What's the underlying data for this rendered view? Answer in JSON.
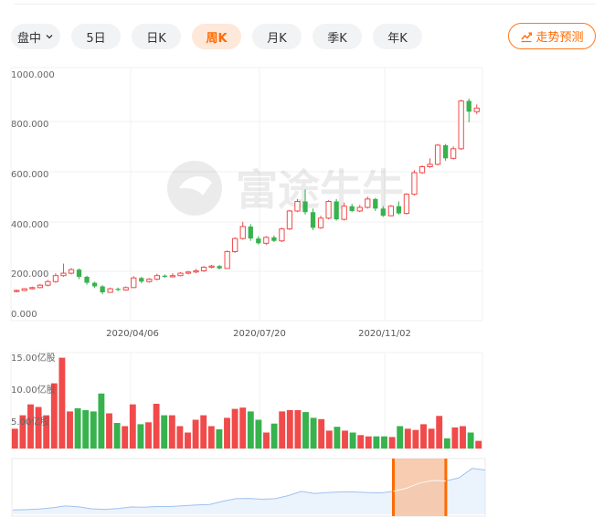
{
  "toolbar": {
    "tabs": [
      {
        "label": "盘中",
        "dropdown": true
      },
      {
        "label": "5日"
      },
      {
        "label": "日K"
      },
      {
        "label": "周K",
        "active": true
      },
      {
        "label": "月K"
      },
      {
        "label": "季K"
      },
      {
        "label": "年K"
      }
    ],
    "forecast_label": "走势预测"
  },
  "watermark": "富途牛牛",
  "colors": {
    "up": "#f04a4a",
    "down": "#37b24d",
    "accent": "#ff6a00",
    "grid": "#f0f0f0"
  },
  "chart_data": [
    {
      "type": "candlestick",
      "name": "price",
      "ylim": [
        0,
        1000
      ],
      "yticks": [
        "1000.000",
        "800.000",
        "600.000",
        "400.000",
        "200.000",
        "0.000"
      ],
      "xticks": [
        "2020/04/06",
        "2020/07/20",
        "2020/11/02"
      ],
      "candles": [
        [
          85,
          88,
          80,
          92
        ],
        [
          88,
          95,
          85,
          98
        ],
        [
          95,
          100,
          92,
          104
        ],
        [
          100,
          110,
          97,
          115
        ],
        [
          110,
          125,
          105,
          132
        ],
        [
          125,
          150,
          120,
          160
        ],
        [
          150,
          160,
          145,
          200
        ],
        [
          160,
          175,
          155,
          182
        ],
        [
          175,
          145,
          135,
          180
        ],
        [
          145,
          120,
          112,
          150
        ],
        [
          120,
          105,
          98,
          125
        ],
        [
          105,
          80,
          72,
          110
        ],
        [
          80,
          95,
          78,
          100
        ],
        [
          95,
          90,
          85,
          100
        ],
        [
          90,
          100,
          87,
          105
        ],
        [
          100,
          140,
          98,
          148
        ],
        [
          140,
          125,
          118,
          145
        ],
        [
          125,
          135,
          120,
          140
        ],
        [
          135,
          150,
          130,
          158
        ],
        [
          150,
          145,
          140,
          155
        ],
        [
          145,
          150,
          142,
          160
        ],
        [
          150,
          160,
          147,
          165
        ],
        [
          160,
          165,
          155,
          170
        ],
        [
          165,
          170,
          160,
          178
        ],
        [
          170,
          185,
          165,
          190
        ],
        [
          185,
          190,
          180,
          195
        ],
        [
          190,
          180,
          175,
          195
        ],
        [
          180,
          250,
          178,
          255
        ],
        [
          250,
          305,
          245,
          310
        ],
        [
          305,
          355,
          300,
          375
        ],
        [
          355,
          305,
          295,
          365
        ],
        [
          305,
          285,
          280,
          315
        ],
        [
          285,
          310,
          278,
          315
        ],
        [
          310,
          295,
          290,
          318
        ],
        [
          295,
          345,
          290,
          350
        ],
        [
          345,
          420,
          340,
          425
        ],
        [
          420,
          460,
          415,
          470
        ],
        [
          460,
          415,
          405,
          510
        ],
        [
          415,
          350,
          340,
          430
        ],
        [
          350,
          390,
          345,
          400
        ],
        [
          390,
          460,
          385,
          465
        ],
        [
          460,
          385,
          380,
          470
        ],
        [
          385,
          440,
          380,
          455
        ],
        [
          440,
          420,
          415,
          450
        ],
        [
          420,
          435,
          415,
          445
        ],
        [
          435,
          470,
          430,
          480
        ],
        [
          470,
          430,
          420,
          475
        ],
        [
          430,
          400,
          395,
          440
        ],
        [
          400,
          440,
          398,
          445
        ],
        [
          440,
          410,
          405,
          460
        ],
        [
          410,
          490,
          405,
          495
        ],
        [
          490,
          580,
          485,
          590
        ],
        [
          580,
          605,
          575,
          610
        ],
        [
          605,
          615,
          600,
          640
        ],
        [
          615,
          695,
          610,
          700
        ],
        [
          695,
          640,
          630,
          700
        ],
        [
          640,
          680,
          635,
          690
        ],
        [
          680,
          880,
          675,
          885
        ],
        [
          880,
          835,
          790,
          890
        ],
        [
          835,
          850,
          825,
          865
        ]
      ]
    },
    {
      "type": "bar",
      "name": "volume",
      "ylim": [
        0,
        15
      ],
      "yticks": [
        "15.00亿股",
        "10.00亿股",
        "5.00亿股"
      ],
      "values": [
        3.1,
        5.2,
        6.9,
        6.5,
        5.2,
        10.2,
        14.2,
        5.8,
        6.3,
        6.0,
        5.8,
        8.6,
        5.5,
        4.0,
        3.5,
        6.9,
        3.8,
        4.1,
        7.0,
        5.2,
        5.2,
        3.5,
        2.5,
        4.5,
        5.2,
        3.5,
        3.0,
        4.8,
        6.2,
        6.4,
        5.8,
        4.5,
        2.5,
        3.9,
        5.8,
        6.0,
        6.0,
        5.7,
        4.8,
        4.6,
        2.8,
        3.4,
        2.8,
        2.5,
        2.1,
        1.9,
        1.9,
        1.9,
        1.8,
        3.5,
        3.1,
        2.9,
        3.8,
        3.1,
        5.1,
        1.6,
        3.3,
        3.5,
        2.5,
        1.2
      ]
    },
    {
      "type": "area",
      "name": "overview",
      "ylim": [
        0,
        1000
      ],
      "values": [
        85,
        90,
        100,
        125,
        160,
        145,
        105,
        95,
        110,
        140,
        135,
        150,
        150,
        165,
        180,
        190,
        250,
        300,
        305,
        290,
        300,
        360,
        440,
        400,
        420,
        430,
        430,
        420,
        410,
        440,
        500,
        600,
        650,
        640,
        700,
        880,
        850
      ],
      "selection": {
        "start_index": 29,
        "end_index": 33
      }
    }
  ]
}
